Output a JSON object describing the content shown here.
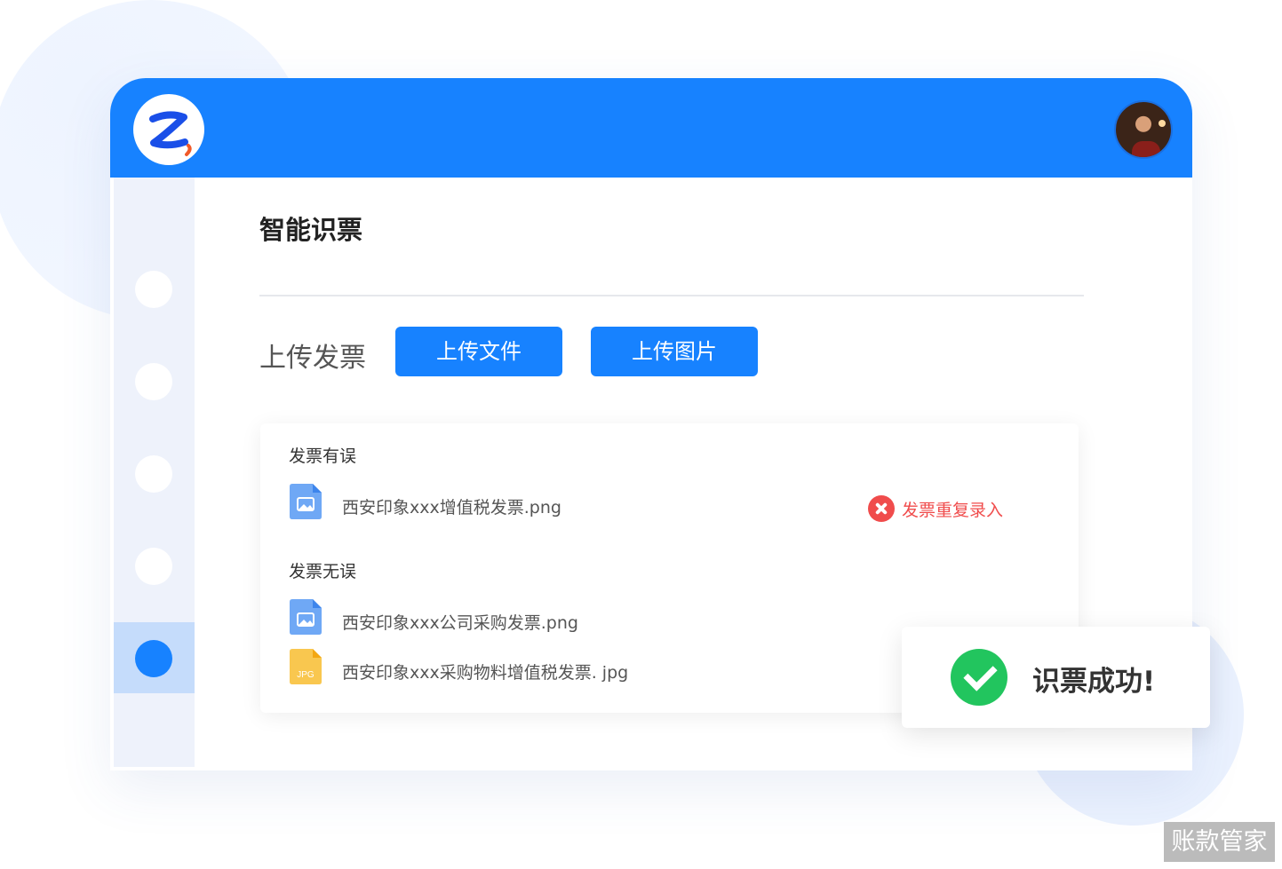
{
  "app": {
    "logo_name": "z-logo"
  },
  "page": {
    "title": "智能识票"
  },
  "upload": {
    "label": "上传发票",
    "file_button": "上传文件",
    "image_button": "上传图片"
  },
  "sections": {
    "error": {
      "title": "发票有误",
      "files": [
        {
          "name": "西安印象xxx增值税发票.png",
          "type": "png",
          "status": "发票重复录入"
        }
      ]
    },
    "ok": {
      "title": "发票无误",
      "files": [
        {
          "name": "西安印象xxx公司采购发票.png",
          "type": "png"
        },
        {
          "name": "西安印象xxx采购物料增值税发票. jpg",
          "type": "jpg",
          "icon_label": "JPG"
        }
      ]
    }
  },
  "toast": {
    "message": "识票成功!"
  },
  "watermark": "账款管家",
  "colors": {
    "primary": "#1782ff",
    "error": "#f04c4c",
    "success": "#22c55e"
  }
}
